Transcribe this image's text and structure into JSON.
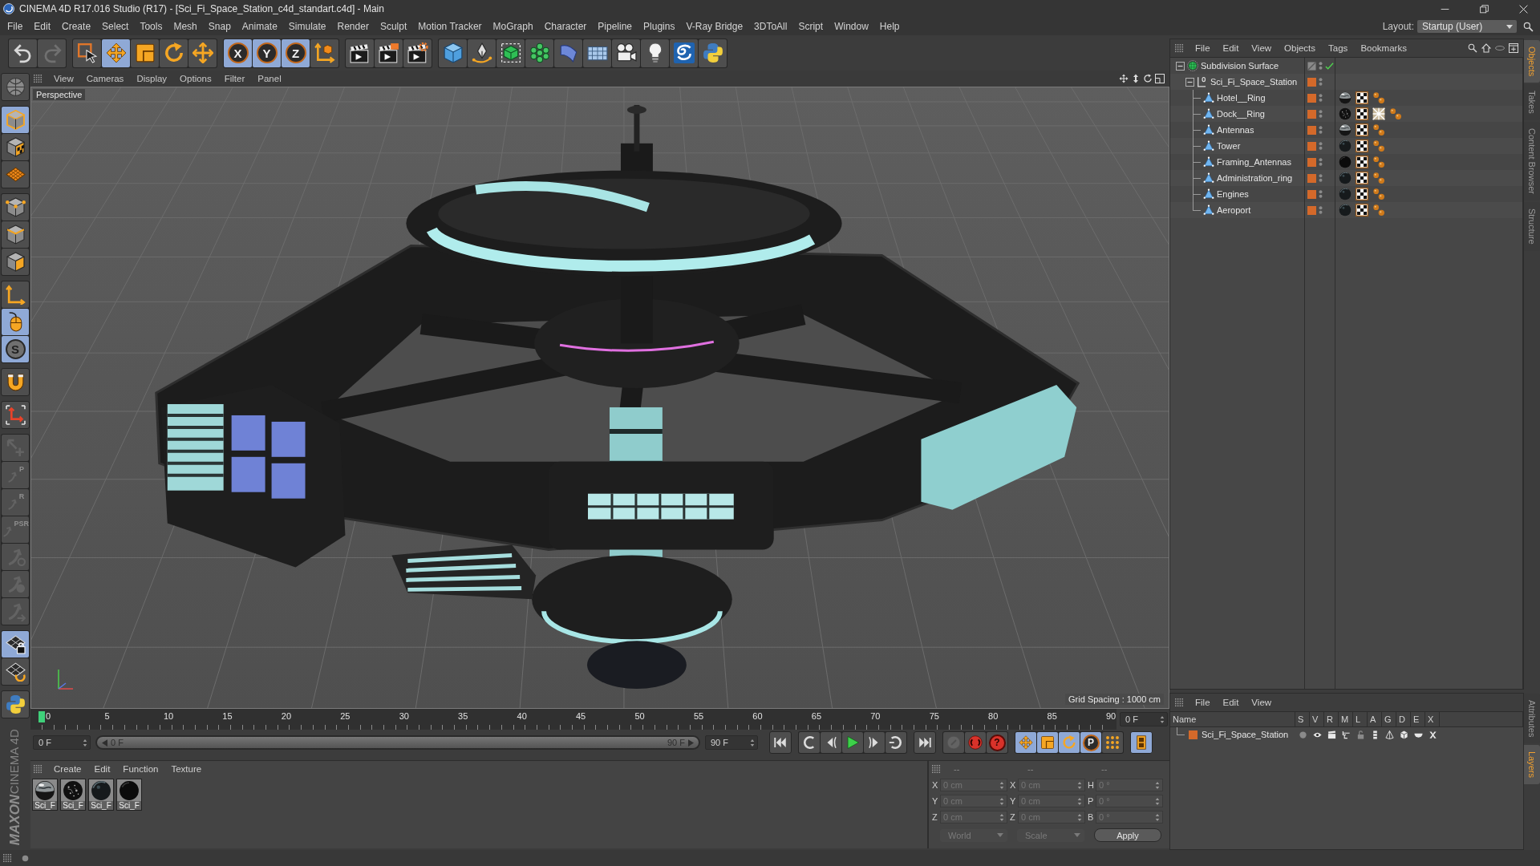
{
  "window": {
    "title": "CINEMA 4D R17.016 Studio (R17) - [Sci_Fi_Space_Station_c4d_standart.c4d] - Main",
    "layout_label": "Layout:",
    "layout_value": "Startup (User)"
  },
  "menu": [
    "File",
    "Edit",
    "Create",
    "Select",
    "Tools",
    "Mesh",
    "Snap",
    "Animate",
    "Simulate",
    "Render",
    "Sculpt",
    "Motion Tracker",
    "MoGraph",
    "Character",
    "Pipeline",
    "Plugins",
    "V-Ray Bridge",
    "3DToAll",
    "Script",
    "Window",
    "Help"
  ],
  "toolbar": [
    {
      "tools": [
        {
          "kind": "undo",
          "selected": false,
          "disabled": false
        },
        {
          "kind": "redo",
          "selected": false,
          "disabled": true
        }
      ]
    },
    {
      "tools": [
        {
          "kind": "live-select",
          "selected": false,
          "disabled": false
        },
        {
          "kind": "move",
          "selected": true,
          "disabled": false
        },
        {
          "kind": "scale",
          "selected": false,
          "disabled": false
        },
        {
          "kind": "rotate",
          "selected": false,
          "disabled": false
        },
        {
          "kind": "transform",
          "selected": false,
          "disabled": false
        }
      ]
    },
    {
      "tools": [
        {
          "kind": "axis",
          "label": "X",
          "selected": true,
          "disabled": false
        },
        {
          "kind": "axis",
          "label": "Y",
          "selected": true,
          "disabled": false
        },
        {
          "kind": "axis",
          "label": "Z",
          "selected": true,
          "disabled": false
        },
        {
          "kind": "coords",
          "selected": false,
          "disabled": false
        }
      ]
    },
    {
      "tools": [
        {
          "kind": "render-view",
          "selected": false,
          "disabled": false
        },
        {
          "kind": "render-picture",
          "selected": false,
          "disabled": false
        },
        {
          "kind": "render-settings",
          "selected": false,
          "disabled": false
        }
      ]
    },
    {
      "tools": [
        {
          "kind": "cube",
          "selected": false,
          "disabled": false
        },
        {
          "kind": "pen",
          "selected": false,
          "disabled": false
        },
        {
          "kind": "subdivision",
          "selected": false,
          "disabled": false
        },
        {
          "kind": "cloner",
          "selected": false,
          "disabled": false
        },
        {
          "kind": "bend",
          "selected": false,
          "disabled": false
        },
        {
          "kind": "floor",
          "selected": false,
          "disabled": false
        },
        {
          "kind": "camera",
          "selected": false,
          "disabled": false
        },
        {
          "kind": "light",
          "selected": false,
          "disabled": false
        },
        {
          "kind": "sketch",
          "selected": false,
          "disabled": false
        },
        {
          "kind": "python",
          "selected": false,
          "disabled": false
        }
      ]
    }
  ],
  "tool_palette": [
    {
      "tools": [
        {
          "kind": "make-editable",
          "selected": false,
          "disabled": false
        }
      ]
    },
    {
      "tools": [
        {
          "kind": "model",
          "selected": true,
          "disabled": false
        },
        {
          "kind": "texture",
          "selected": false,
          "disabled": false
        },
        {
          "kind": "workplane",
          "selected": false,
          "disabled": false
        }
      ]
    },
    {
      "tools": [
        {
          "kind": "points",
          "selected": false,
          "disabled": false
        },
        {
          "kind": "edges",
          "selected": false,
          "disabled": false
        },
        {
          "kind": "polygons",
          "selected": false,
          "disabled": false
        }
      ]
    },
    {
      "tools": [
        {
          "kind": "axis-mode",
          "selected": false,
          "disabled": false
        },
        {
          "kind": "tweak",
          "selected": true,
          "disabled": false
        },
        {
          "kind": "solo",
          "label": "S",
          "selected": true,
          "disabled": false
        }
      ]
    },
    {
      "tools": [
        {
          "kind": "snap",
          "selected": false,
          "disabled": false
        }
      ]
    },
    {
      "tools": [
        {
          "kind": "axis-corners",
          "selected": false,
          "disabled": false
        }
      ]
    },
    {
      "tools": [
        {
          "kind": "arrow-plus",
          "selected": false,
          "disabled": true
        },
        {
          "kind": "curved-arrow",
          "label": "P",
          "selected": false,
          "disabled": true
        },
        {
          "kind": "curved-arrow",
          "label": "R",
          "selected": false,
          "disabled": true
        },
        {
          "kind": "curved-arrow",
          "label": "PSR",
          "selected": false,
          "disabled": true
        },
        {
          "kind": "curved-arrow-ring",
          "selected": false,
          "disabled": true
        },
        {
          "kind": "curved-arrow-ball",
          "selected": false,
          "disabled": true
        },
        {
          "kind": "curved-arrow-right",
          "selected": false,
          "disabled": true
        }
      ]
    },
    {
      "tools": [
        {
          "kind": "workplane-lock",
          "selected": true,
          "disabled": false
        },
        {
          "kind": "grid-rotate",
          "selected": false,
          "disabled": false
        }
      ]
    },
    {
      "tools": [
        {
          "kind": "python",
          "selected": false,
          "disabled": false
        }
      ]
    }
  ],
  "viewport": {
    "menu": [
      "View",
      "Cameras",
      "Display",
      "Options",
      "Filter",
      "Panel"
    ],
    "camera_label": "Perspective",
    "grid_spacing": "Grid Spacing : 1000 cm"
  },
  "timeline": {
    "ruler_labels": [
      "0",
      "5",
      "10",
      "15",
      "20",
      "25",
      "30",
      "35",
      "40",
      "45",
      "50",
      "55",
      "60",
      "65",
      "70",
      "75",
      "80",
      "85",
      "90"
    ],
    "level": 0,
    "current_frame": "0 F",
    "start_field": "0 F",
    "range": {
      "start": "0 F",
      "end": "90 F",
      "level": 1
    },
    "end_field": "90 F",
    "buttons": [
      {
        "tools": [
          {
            "kind": "go-start",
            "selected": false,
            "disabled": false
          }
        ]
      },
      {
        "tools": [
          {
            "kind": "prev-key",
            "selected": false,
            "disabled": false
          },
          {
            "kind": "prev-frame",
            "selected": false,
            "disabled": false
          },
          {
            "kind": "play",
            "selected": false,
            "disabled": false
          },
          {
            "kind": "next-frame",
            "selected": false,
            "disabled": false
          },
          {
            "kind": "next-key",
            "selected": false,
            "disabled": false
          }
        ]
      },
      {
        "tools": [
          {
            "kind": "go-end",
            "selected": false,
            "disabled": false
          }
        ]
      },
      {
        "tools": [
          {
            "kind": "record",
            "selected": false,
            "disabled": true
          },
          {
            "kind": "autokey",
            "selected": false,
            "disabled": false
          },
          {
            "kind": "key-selection",
            "label": "?",
            "selected": false,
            "disabled": false
          }
        ]
      },
      {
        "tools": [
          {
            "kind": "move",
            "selected": true,
            "disabled": false
          },
          {
            "kind": "scale",
            "selected": true,
            "disabled": false
          },
          {
            "kind": "rotate",
            "selected": true,
            "disabled": false
          },
          {
            "kind": "param-key",
            "label": "P",
            "selected": true,
            "disabled": false
          },
          {
            "kind": "point-key",
            "selected": false,
            "disabled": false
          }
        ]
      },
      {
        "tools": [
          {
            "kind": "film",
            "selected": true,
            "disabled": false
          }
        ]
      }
    ]
  },
  "materials": {
    "menu": [
      "Create",
      "Edit",
      "Function",
      "Texture"
    ],
    "items": [
      {
        "name": "Sci_F",
        "kind": "shiny"
      },
      {
        "name": "Sci_F",
        "kind": "speckled"
      },
      {
        "name": "Sci_F",
        "kind": "dark"
      },
      {
        "name": "Sci_F",
        "kind": "black"
      }
    ]
  },
  "coordinates": {
    "headers": [
      "--",
      "--",
      "--"
    ],
    "disabled": true,
    "columns": [
      {
        "fields": [
          {
            "axis": "X",
            "value": "0 cm"
          },
          {
            "axis": "Y",
            "value": "0 cm"
          },
          {
            "axis": "Z",
            "value": "0 cm"
          }
        ]
      },
      {
        "fields": [
          {
            "axis": "X",
            "value": "0 cm"
          },
          {
            "axis": "Y",
            "value": "0 cm"
          },
          {
            "axis": "Z",
            "value": "0 cm"
          }
        ]
      },
      {
        "fields": [
          {
            "axis": "H",
            "value": "0 °"
          },
          {
            "axis": "P",
            "value": "0 °"
          },
          {
            "axis": "B",
            "value": "0 °"
          }
        ]
      }
    ],
    "space_dropdown": "World",
    "mode_dropdown": "Scale",
    "apply_button": "Apply"
  },
  "objects": {
    "menu": [
      "File",
      "Edit",
      "View",
      "Objects",
      "Tags",
      "Bookmarks"
    ],
    "tree": [
      {
        "name": "Subdivision Surface",
        "kind": "subdivision",
        "expanded": true,
        "enabled": true,
        "children": [
          {
            "name": "Sci_Fi_Space_Station",
            "kind": "null",
            "expanded": true,
            "color": "#d4692a",
            "children": [
              {
                "name": "Hotel__Ring",
                "kind": "polygon",
                "color": "#d4692a",
                "tags": [
                  {
                    "kind": "material-shiny"
                  },
                  {
                    "kind": "uvw"
                  },
                  {
                    "kind": "phong"
                  }
                ]
              },
              {
                "name": "Dock__Ring",
                "kind": "polygon",
                "color": "#d4692a",
                "tags": [
                  {
                    "kind": "material-speckled"
                  },
                  {
                    "kind": "uvw"
                  },
                  {
                    "kind": "texture"
                  },
                  {
                    "kind": "phong"
                  }
                ]
              },
              {
                "name": "Antennas",
                "kind": "polygon",
                "color": "#d4692a",
                "tags": [
                  {
                    "kind": "material-shiny"
                  },
                  {
                    "kind": "uvw"
                  },
                  {
                    "kind": "phong"
                  }
                ]
              },
              {
                "name": "Tower",
                "kind": "polygon",
                "color": "#d4692a",
                "tags": [
                  {
                    "kind": "material-dark"
                  },
                  {
                    "kind": "uvw"
                  },
                  {
                    "kind": "phong"
                  }
                ]
              },
              {
                "name": "Framing_Antennas",
                "kind": "polygon",
                "color": "#d4692a",
                "tags": [
                  {
                    "kind": "material-black"
                  },
                  {
                    "kind": "uvw"
                  },
                  {
                    "kind": "phong"
                  }
                ]
              },
              {
                "name": "Administration_ring",
                "kind": "polygon",
                "color": "#d4692a",
                "tags": [
                  {
                    "kind": "material-dark"
                  },
                  {
                    "kind": "uvw"
                  },
                  {
                    "kind": "phong"
                  }
                ]
              },
              {
                "name": "Engines",
                "kind": "polygon",
                "color": "#d4692a",
                "tags": [
                  {
                    "kind": "material-dark"
                  },
                  {
                    "kind": "uvw"
                  },
                  {
                    "kind": "phong"
                  }
                ]
              },
              {
                "name": "Aeroport",
                "kind": "polygon",
                "color": "#d4692a",
                "tags": [
                  {
                    "kind": "material-dark"
                  },
                  {
                    "kind": "uvw"
                  },
                  {
                    "kind": "phong"
                  }
                ]
              }
            ]
          }
        ]
      }
    ]
  },
  "layers": {
    "menu": [
      "File",
      "Edit",
      "View"
    ],
    "columns": [
      "Name",
      "S",
      "V",
      "R",
      "M",
      "L",
      "A",
      "G",
      "D",
      "E",
      "X"
    ],
    "items": [
      {
        "name": "Sci_Fi_Space_Station",
        "color": "#d4692a",
        "flags": [
          false,
          true,
          true,
          true,
          false,
          true,
          true,
          true,
          true,
          true
        ]
      }
    ]
  },
  "side_tabs": {
    "top": [
      {
        "label": "Objects",
        "selected": true
      },
      {
        "label": "Takes",
        "selected": false
      },
      {
        "label": "Content Browser",
        "selected": false
      },
      {
        "label": "Structure",
        "selected": false
      }
    ],
    "bottom": [
      {
        "label": "Attributes",
        "selected": false
      },
      {
        "label": "Layers",
        "selected": true
      }
    ]
  },
  "brand": {
    "company": "MAXON",
    "product": "CINEMA 4D"
  }
}
